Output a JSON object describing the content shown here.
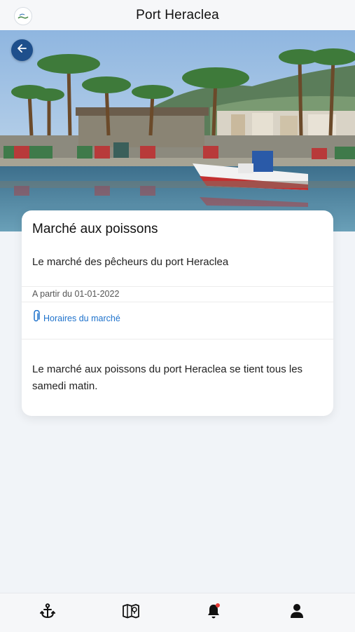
{
  "header": {
    "title": "Port Heraclea",
    "logo_icon": "harbour-logo-icon"
  },
  "hero": {
    "image": "harbour-fish-market-photo",
    "back_icon": "arrow-left-icon"
  },
  "card": {
    "title": "Marché aux poissons",
    "subtitle": "Le marché des pêcheurs du port Heraclea",
    "date": "A partir du 01-01-2022",
    "link_label": "Horaires du marché",
    "link_icon": "paperclip-icon",
    "description": "Le marché aux poissons du port Heraclea se tient tous les samedi matin."
  },
  "navbar": {
    "items": [
      {
        "icon": "anchor-icon"
      },
      {
        "icon": "map-icon"
      },
      {
        "icon": "bell-icon",
        "badge": true
      },
      {
        "icon": "user-icon"
      }
    ]
  },
  "colors": {
    "accent": "#1e4f8c",
    "link": "#1e72cc",
    "badge": "#e53935"
  }
}
